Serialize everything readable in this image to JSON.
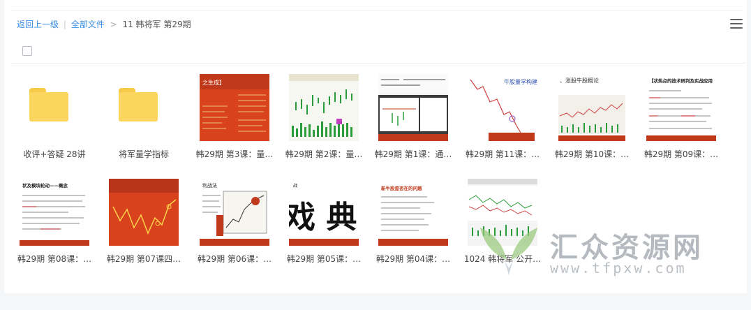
{
  "breadcrumb": {
    "back_label": "返回上一级",
    "separator": "|",
    "all_files_label": "全部文件",
    "arrow": ">",
    "current_folder": "11 韩将军 第29期"
  },
  "files": [
    {
      "name": "收评+答疑 28讲",
      "type": "folder"
    },
    {
      "name": "将军量学指标",
      "type": "folder"
    },
    {
      "name": "韩29期 第3课：量…",
      "type": "image",
      "thumb_caption": "之生成】"
    },
    {
      "name": "韩29期 第2课：量…",
      "type": "image"
    },
    {
      "name": "韩29期 第1课：通…",
      "type": "image"
    },
    {
      "name": "韩29期 第11课：…",
      "type": "image",
      "thumb_caption": "牛股量学构建"
    },
    {
      "name": "韩29期 第10课：…",
      "type": "image",
      "thumb_caption": "、涨股牛股概论"
    },
    {
      "name": "韩29期 第09课：…",
      "type": "image",
      "thumb_caption": "【状热点的技术研判及实战应用"
    },
    {
      "name": "韩29期 第08课：…",
      "type": "image",
      "thumb_caption": "状及模块轮动——概念"
    },
    {
      "name": "韩29期 第07课四…",
      "type": "image"
    },
    {
      "name": "韩29期 第06课：…",
      "type": "image",
      "thumb_caption": "利战法"
    },
    {
      "name": "韩29期 第05课：…",
      "type": "image",
      "thumb_caption": "戏 典"
    },
    {
      "name": "韩29期 第04课：…",
      "type": "image",
      "thumb_caption": "新牛股是否在的问题"
    },
    {
      "name": "1024 韩将军 公开…",
      "type": "image"
    }
  ],
  "watermark": {
    "title": "汇众资源网",
    "url": "www.tfpxw.com"
  },
  "colors": {
    "link": "#3a8ee6",
    "folder": "#fad65e",
    "slide_red": "#c0391b",
    "slide_orange": "#e0561f"
  }
}
